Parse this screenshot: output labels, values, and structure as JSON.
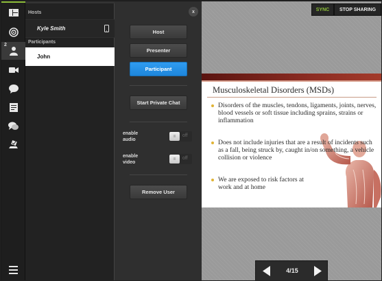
{
  "rail": {
    "badge": "2",
    "icons": [
      "layout-icon",
      "target-icon",
      "people-icon",
      "video-camera-icon",
      "chat-bubble-icon",
      "notes-icon",
      "qa-icon",
      "poll-icon",
      "menu-icon"
    ]
  },
  "people": {
    "hosts_label": "Hosts",
    "host_name": "Kyle Smith",
    "participants_label": "Participants",
    "selected_participant": "John"
  },
  "roles": {
    "close_label": "x",
    "host_label": "Host",
    "presenter_label": "Presenter",
    "participant_label": "Participant",
    "active_role": "Participant",
    "private_chat_label": "Start Private Chat",
    "enable_audio_label": "enable\naudio",
    "enable_audio_state": "off",
    "enable_video_label": "enable\nvideo",
    "enable_video_state": "off",
    "knob_label": "III",
    "remove_user_label": "Remove User"
  },
  "stage": {
    "sync_label": "SYNC",
    "stop_sharing_label": "STOP SHARING",
    "slide": {
      "title": "Musculoskeletal Disorders (MSDs)",
      "bullets": [
        "Disorders of the muscles, tendons, ligaments, joints, nerves, blood vessels or soft tissue including sprains, strains or inflammation",
        "Does not include injuries that are a result of incidents such as a fall, being struck by, caught in/on something, a vehicle collision or violence",
        "We are exposed to risk factors at work and at home"
      ]
    },
    "pager": {
      "page_text": "4/15",
      "current_page": 4,
      "total_pages": 15
    }
  },
  "colors": {
    "accent_blue": "#1e86db",
    "sync_green": "#8fc23b",
    "slide_band": "#8c2c22",
    "bullet_gold": "#e0b335"
  }
}
